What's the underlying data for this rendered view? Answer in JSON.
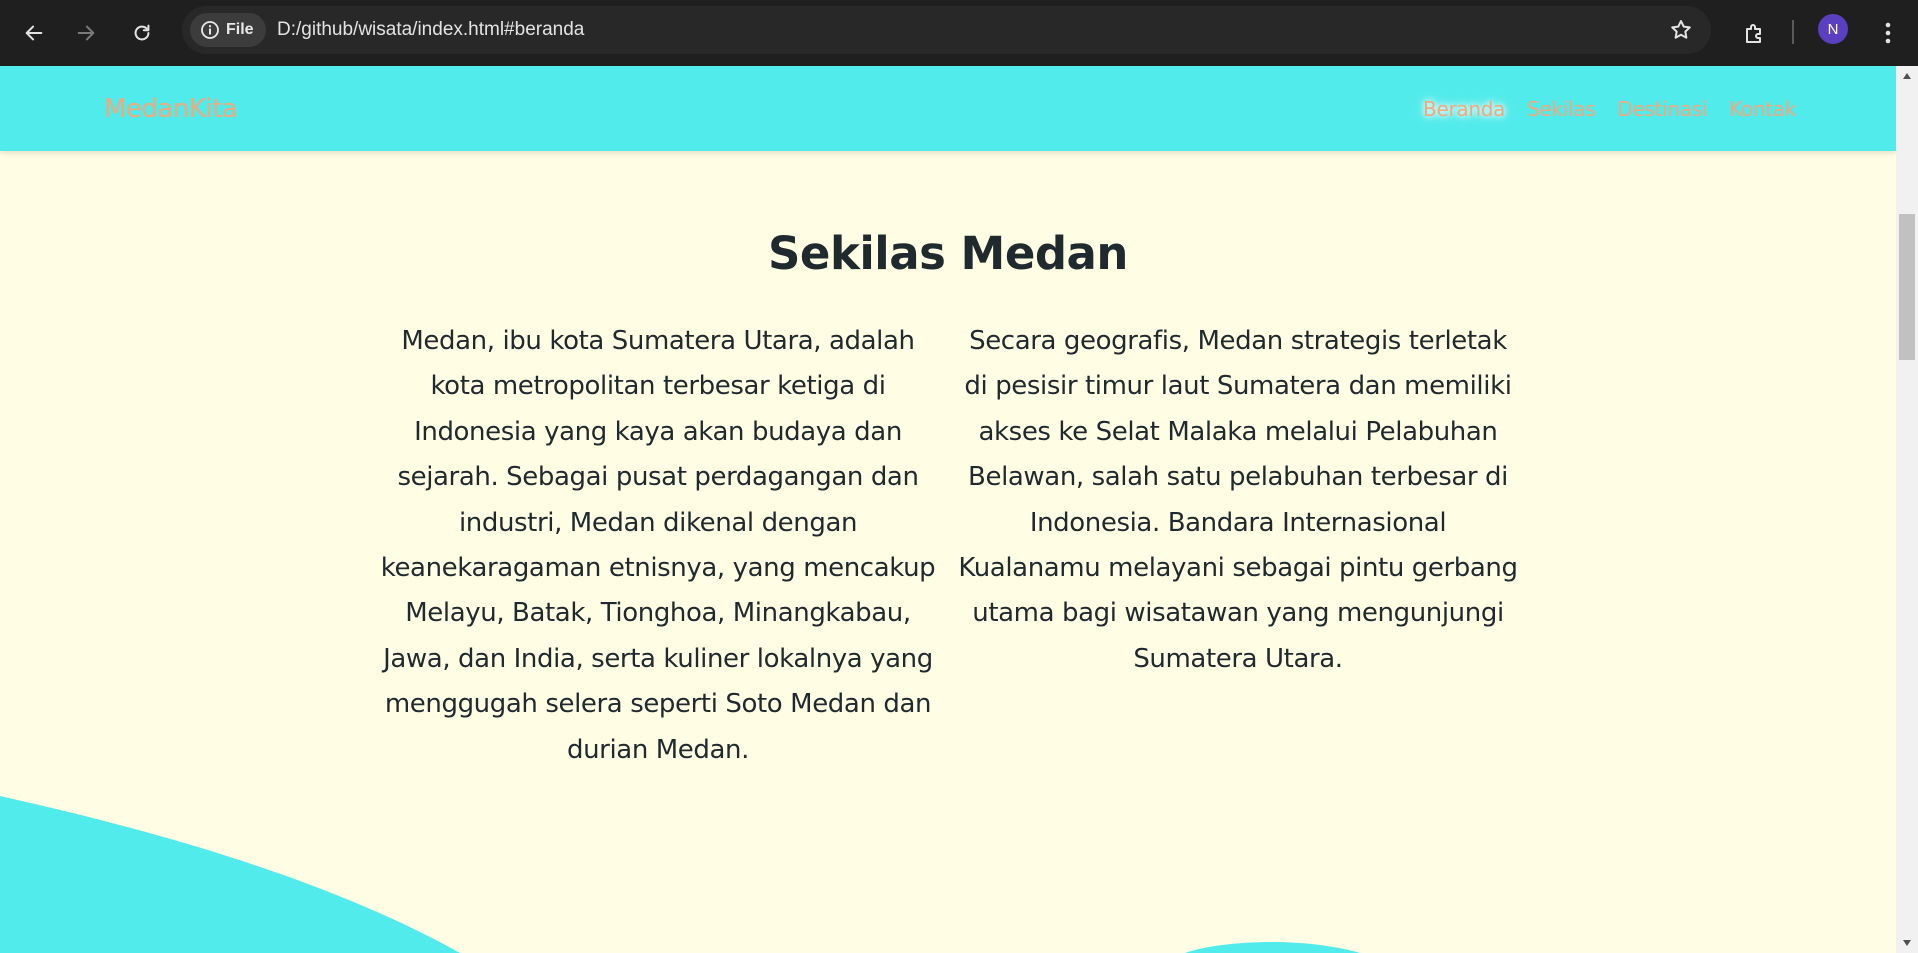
{
  "browser": {
    "url": "D:/github/wisata/index.html#beranda",
    "site_chip_label": "File",
    "profile_initial": "N",
    "icons": [
      "back-arrow-icon",
      "forward-arrow-icon",
      "reload-icon",
      "info-icon",
      "star-icon",
      "extensions-icon",
      "kebab-menu-icon"
    ]
  },
  "navbar": {
    "brand": "MedanKita",
    "links": [
      {
        "label": "Beranda",
        "active": true
      },
      {
        "label": "Sekilas",
        "active": false
      },
      {
        "label": "Destinasi",
        "active": false
      },
      {
        "label": "Kontak",
        "active": false
      }
    ]
  },
  "section": {
    "title": "Sekilas Medan",
    "paragraphs": [
      "Medan, ibu kota Sumatera Utara, adalah kota metropolitan terbesar ketiga di Indonesia yang kaya akan budaya dan sejarah. Sebagai pusat perdagangan dan industri, Medan dikenal dengan keanekaragaman etnisnya, yang mencakup Melayu, Batak, Tionghoa, Minangkabau, Jawa, dan India, serta kuliner lokalnya yang menggugah selera seperti Soto Medan dan durian Medan.",
      "Secara geografis, Medan strategis terletak di pesisir timur laut Sumatera dan memiliki akses ke Selat Malaka melalui Pelabuhan Belawan, salah satu pelabuhan terbesar di Indonesia. Bandara Internasional Kualanamu melayani sebagai pintu gerbang utama bagi wisatawan yang mengunjungi Sumatera Utara."
    ]
  },
  "colors": {
    "navbar_bg": "#52ebeb",
    "page_bg": "#fffde3",
    "link_color": "#f0a97c",
    "text_color": "#1f2a2f",
    "wave_color": "#52ebeb"
  }
}
